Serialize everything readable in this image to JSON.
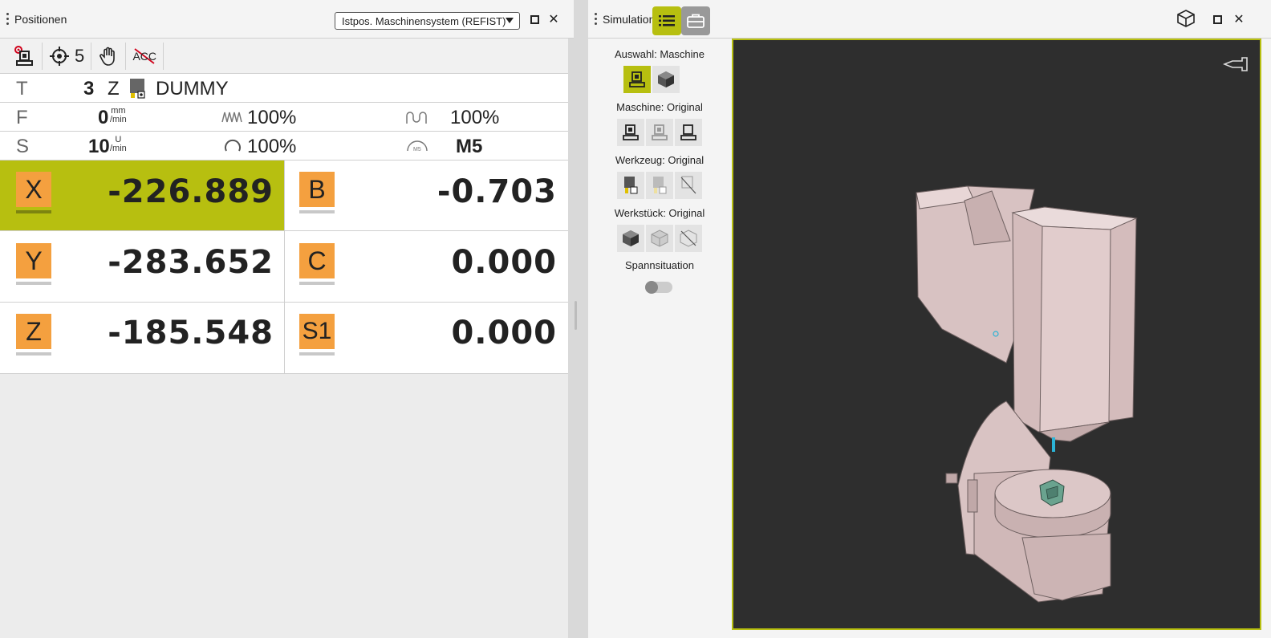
{
  "positions_panel": {
    "title": "Positionen",
    "coord_system": "Istpos. Maschinensystem (REFIST)",
    "toolbar": {
      "target_count": "5",
      "acc_label": "ACC"
    },
    "tool_row": {
      "label": "T",
      "tool_number": "3",
      "tool_axis": "Z",
      "tool_name": "DUMMY"
    },
    "feed_row": {
      "label": "F",
      "value": "0",
      "unit_top": "mm",
      "unit_bottom": "/min",
      "feed_override": "100",
      "rapid_override": "100",
      "pct_sign": "%"
    },
    "spindle_row": {
      "label": "S",
      "value": "10",
      "unit_top": "U",
      "unit_bottom": "/min",
      "spindle_override": "100",
      "pct_sign": "%",
      "m_function": "M5",
      "m_icon_text": "M5"
    },
    "axes": [
      {
        "name": "X",
        "value": "-226.889"
      },
      {
        "name": "B",
        "value": "-0.703"
      },
      {
        "name": "Y",
        "value": "-283.652"
      },
      {
        "name": "C",
        "value": "0.000"
      },
      {
        "name": "Z",
        "value": "-185.548"
      },
      {
        "name": "S1",
        "value": "0.000"
      }
    ]
  },
  "simulation_panel": {
    "title": "Simulation",
    "side": {
      "auswahl": "Auswahl: Maschine",
      "maschine": "Maschine: Original",
      "werkzeug": "Werkzeug: Original",
      "werkstueck": "Werkstück: Original",
      "spannsituation": "Spannsituation"
    }
  },
  "colors": {
    "accent": "#b7bf10",
    "axis_badge": "#f4a03f",
    "viewport_bg": "#2e2e2e",
    "machine": "#d9c4c4"
  }
}
